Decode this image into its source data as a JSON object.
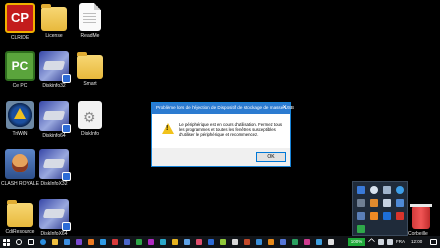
{
  "desktop": {
    "icons": [
      {
        "label": "CLRIDE"
      },
      {
        "label": "License"
      },
      {
        "label": "ReadMe"
      },
      {
        "label": "Ce PC"
      },
      {
        "label": "Diskinfo32"
      },
      {
        "label": "Smart"
      },
      {
        "label": "TriWiN"
      },
      {
        "label": "Diskinfo64"
      },
      {
        "label": "DiskInfo"
      },
      {
        "label": "CLASH ROYALE"
      },
      {
        "label": "DiskInfoX32"
      },
      {
        "label": "CdiResource"
      },
      {
        "label": "DiskInfoX64"
      },
      {
        "label": "Corbeille"
      }
    ],
    "cp_text": "CP",
    "pc_text": "PC"
  },
  "dialog": {
    "title": "Problème lors de l'éjection de Dispositif de stockage de masse USB",
    "close_glyph": "✕",
    "message": "Le périphérique est en cours d'utilisation. Fermez tous les programmes et toutes les fenêtres susceptibles d'utiliser le périphérique et recommencez.",
    "ok_label": "OK"
  },
  "taskbar": {
    "battery": "100%",
    "language": "FRA",
    "time": "12:00"
  },
  "colors": {
    "accent": "#0078d7",
    "titlebar": "#2b7bd1",
    "warning": "#f1c21b",
    "battery": "#1faa3a"
  }
}
